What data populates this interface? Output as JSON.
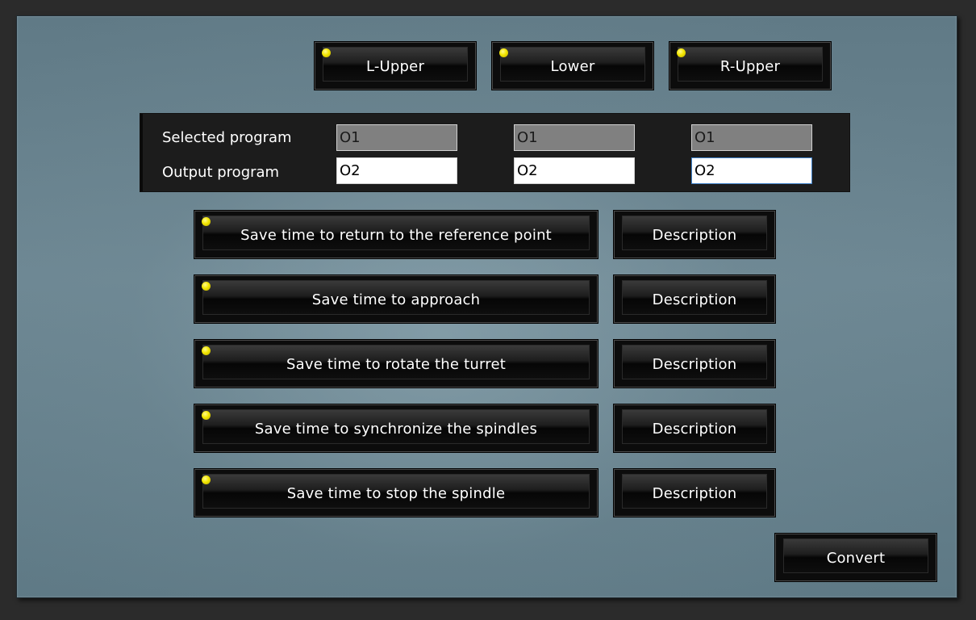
{
  "turrets": [
    {
      "label": "L-Upper",
      "indicator_color": "#f2e600"
    },
    {
      "label": "Lower",
      "indicator_color": "#f2e600"
    },
    {
      "label": "R-Upper",
      "indicator_color": "#f2e600"
    }
  ],
  "programs": {
    "selected_label": "Selected program",
    "output_label": "Output program",
    "selected_values": [
      "O1",
      "O1",
      "O1"
    ],
    "output_values": [
      "O2",
      "O2",
      "O2"
    ]
  },
  "options": [
    {
      "label": "Save time to return to the reference point",
      "description_label": "Description"
    },
    {
      "label": "Save time to approach",
      "description_label": "Description"
    },
    {
      "label": "Save time to rotate the turret",
      "description_label": "Description"
    },
    {
      "label": "Save time to synchronize the spindles",
      "description_label": "Description"
    },
    {
      "label": "Save time to stop the spindle",
      "description_label": "Description"
    }
  ],
  "convert_label": "Convert",
  "colors": {
    "indicator": "#f2e600",
    "panel": "#6d8793",
    "button": "#0c0c0c"
  }
}
